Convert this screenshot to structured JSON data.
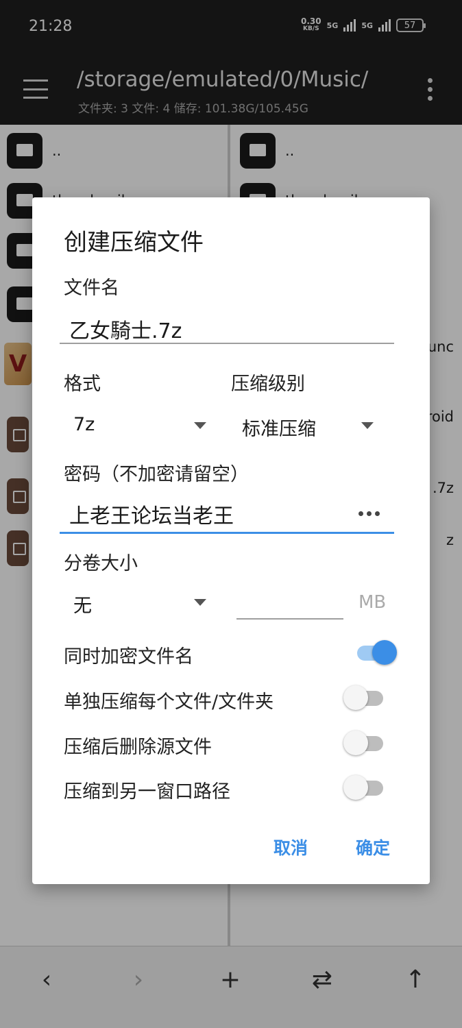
{
  "status": {
    "time": "21:28",
    "net_speed": "0.30",
    "net_unit": "KB/S",
    "sig1_label": "5G",
    "sig2_label": "5G",
    "battery": "57"
  },
  "header": {
    "path": "/storage/emulated/0/Music/",
    "info": "文件夹: 3  文件: 4  储存: 101.38G/105.45G"
  },
  "left_pane": [
    {
      "type": "folder",
      "name": ".."
    },
    {
      "type": "folder",
      "name": "thumbnails"
    },
    {
      "type": "folder",
      "name": ""
    },
    {
      "type": "folder",
      "name": ""
    },
    {
      "type": "album",
      "name": ""
    },
    {
      "type": "archive",
      "name": ""
    },
    {
      "type": "archive",
      "name": ""
    },
    {
      "type": "archive",
      "name": ""
    }
  ],
  "right_pane": [
    {
      "type": "folder",
      "name": ".."
    },
    {
      "type": "folder",
      "name": "thumbnails"
    }
  ],
  "right_tails": [
    "unc",
    "roid",
    ".7z",
    "z"
  ],
  "dialog": {
    "title": "创建压缩文件",
    "filename_label": "文件名",
    "filename_value": "乙女騎士.7z",
    "format_label": "格式",
    "format_value": "7z",
    "level_label": "压缩级别",
    "level_value": "标准压缩",
    "password_label": "密码（不加密请留空）",
    "password_value": "上老王论坛当老王",
    "split_label": "分卷大小",
    "split_value": "无",
    "split_unit": "MB",
    "switches": [
      {
        "label": "同时加密文件名",
        "on": true
      },
      {
        "label": "单独压缩每个文件/文件夹",
        "on": false
      },
      {
        "label": "压缩后删除源文件",
        "on": false
      },
      {
        "label": "压缩到另一窗口路径",
        "on": false
      }
    ],
    "cancel": "取消",
    "ok": "确定"
  },
  "bottom_bar": {
    "back": "‹",
    "forward": "›",
    "add": "+",
    "swap": "⇄",
    "up": "↑"
  },
  "colors": {
    "accent": "#3b8ee6",
    "appbar": "#1f1f1f"
  }
}
